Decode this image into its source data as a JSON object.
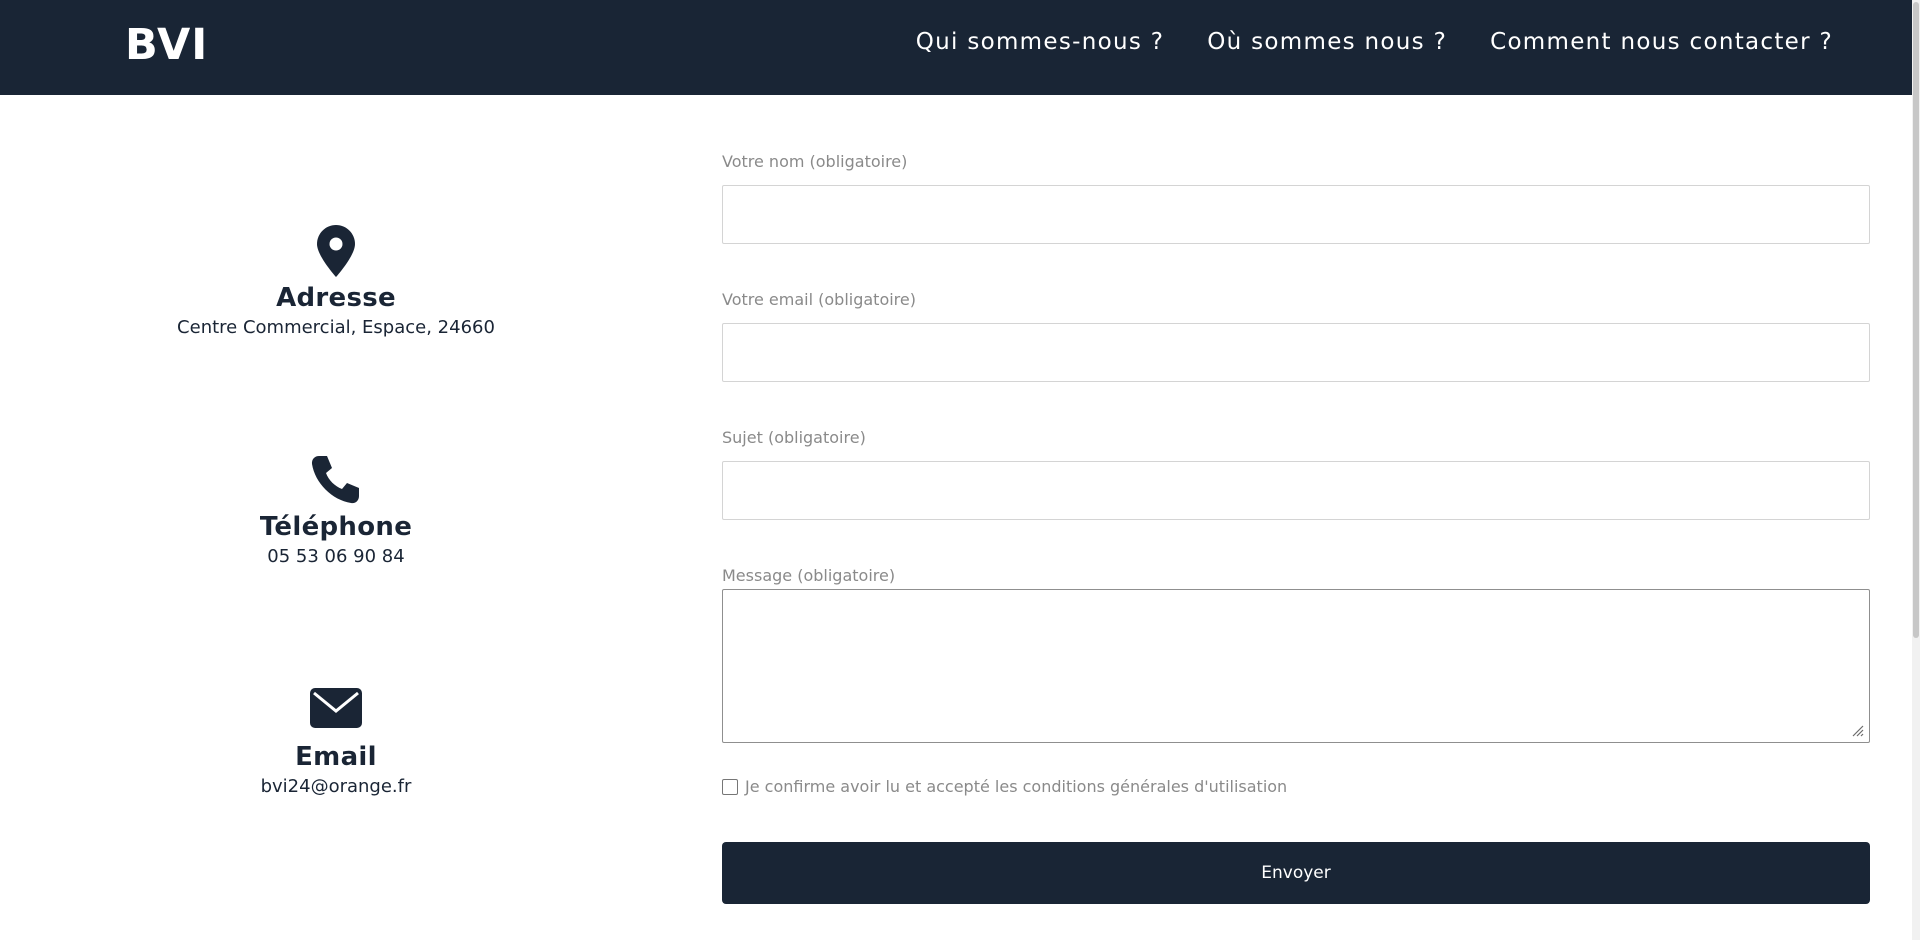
{
  "header": {
    "logo": "BVI",
    "nav": [
      {
        "label": "Qui sommes-nous ?"
      },
      {
        "label": "Où sommes nous ?"
      },
      {
        "label": "Comment nous contacter ?"
      }
    ]
  },
  "contact": {
    "address": {
      "icon": "map-pin-icon",
      "title": "Adresse",
      "value": "Centre Commercial, Espace, 24660"
    },
    "phone": {
      "icon": "phone-icon",
      "title": "Téléphone",
      "value": "05 53 06 90 84"
    },
    "email": {
      "icon": "envelope-icon",
      "title": "Email",
      "value": "bvi24@orange.fr"
    }
  },
  "form": {
    "name": {
      "label": "Votre nom (obligatoire)",
      "value": ""
    },
    "email": {
      "label": "Votre email (obligatoire)",
      "value": ""
    },
    "subject": {
      "label": "Sujet (obligatoire)",
      "value": ""
    },
    "message": {
      "label": "Message (obligatoire)",
      "value": ""
    },
    "consent": {
      "label": "Je confirme avoir lu et accepté les conditions générales d'utilisation",
      "checked": false
    },
    "submit_label": "Envoyer"
  },
  "colors": {
    "primary": "#192535",
    "label_gray": "#8a8a8a",
    "background": "#ffffff"
  }
}
